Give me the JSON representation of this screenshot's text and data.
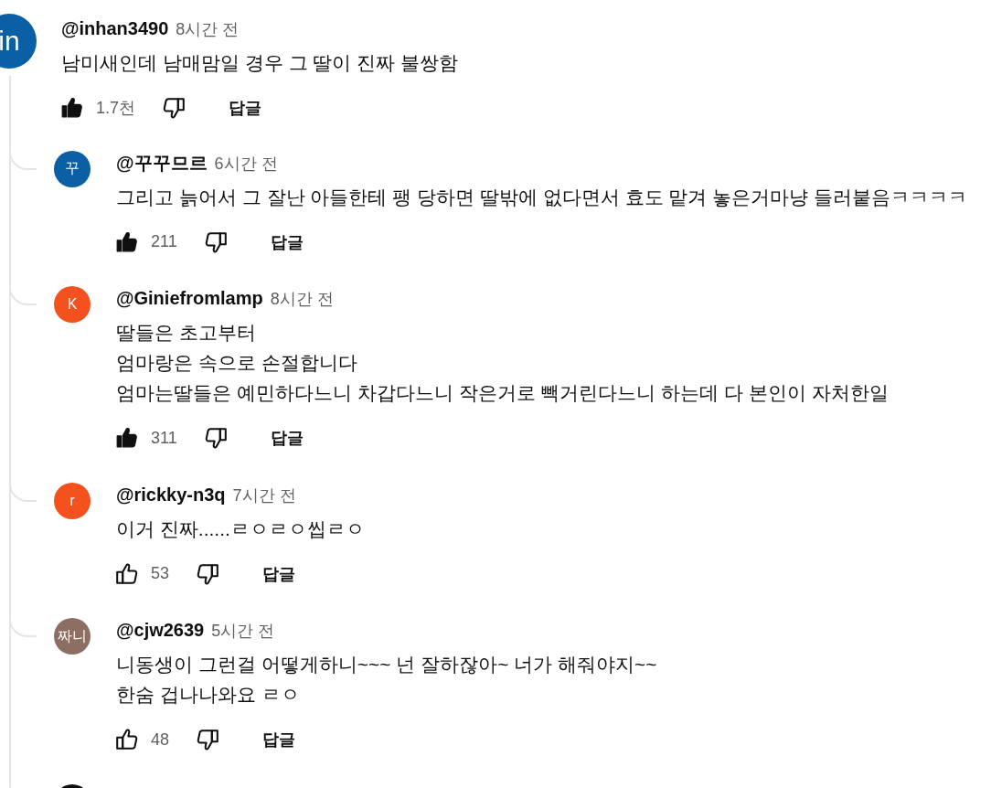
{
  "comments": [
    {
      "avatar_text": "in",
      "color": "#0b5fa5",
      "author": "@inhan3490",
      "time": "8시간 전",
      "text": "남미새인데 남매맘일 경우 그 딸이 진짜 불쌍함",
      "likes": "1.7천",
      "liked": true,
      "reply_label": "답글",
      "replies": [
        {
          "avatar_text": "꾸",
          "color": "#0b5fa5",
          "author": "@꾸꾸므르",
          "time": "6시간 전",
          "text": "그리고 늙어서 그 잘난 아들한테 팽 당하면 딸밖에 없다면서 효도 맡겨 놓은거마냥 들러붙음ㅋㅋㅋㅋ",
          "likes": "211",
          "liked": true,
          "reply_label": "답글"
        },
        {
          "avatar_text": "K",
          "color": "#f4511e",
          "author": "@Giniefromlamp",
          "time": "8시간 전",
          "text": "딸들은 초고부터\n엄마랑은 속으로 손절합니다\n엄마는딸들은 예민하다느니 차갑다느니 작은거로 빽거린다느니 하는데 다 본인이 자처한일",
          "likes": "311",
          "liked": true,
          "reply_label": "답글"
        },
        {
          "avatar_text": "r",
          "color": "#f4511e",
          "author": "@rickky-n3q",
          "time": "7시간 전",
          "text": "이거 진짜......ㄹㅇㄹㅇ씹ㄹㅇ",
          "likes": "53",
          "liked": false,
          "reply_label": "답글"
        },
        {
          "avatar_text": "짜니",
          "color": "#8d6e63",
          "author": "@cjw2639",
          "time": "5시간 전",
          "text": "니동생이 그런걸 어떻게하니~~~ 넌 잘하잖아~ 너가 해줘야지~~\n한숨 겁나나와요 ㄹㅇ",
          "likes": "48",
          "liked": false,
          "reply_label": "답글"
        },
        {
          "color": "#0f0f0f"
        }
      ]
    }
  ]
}
